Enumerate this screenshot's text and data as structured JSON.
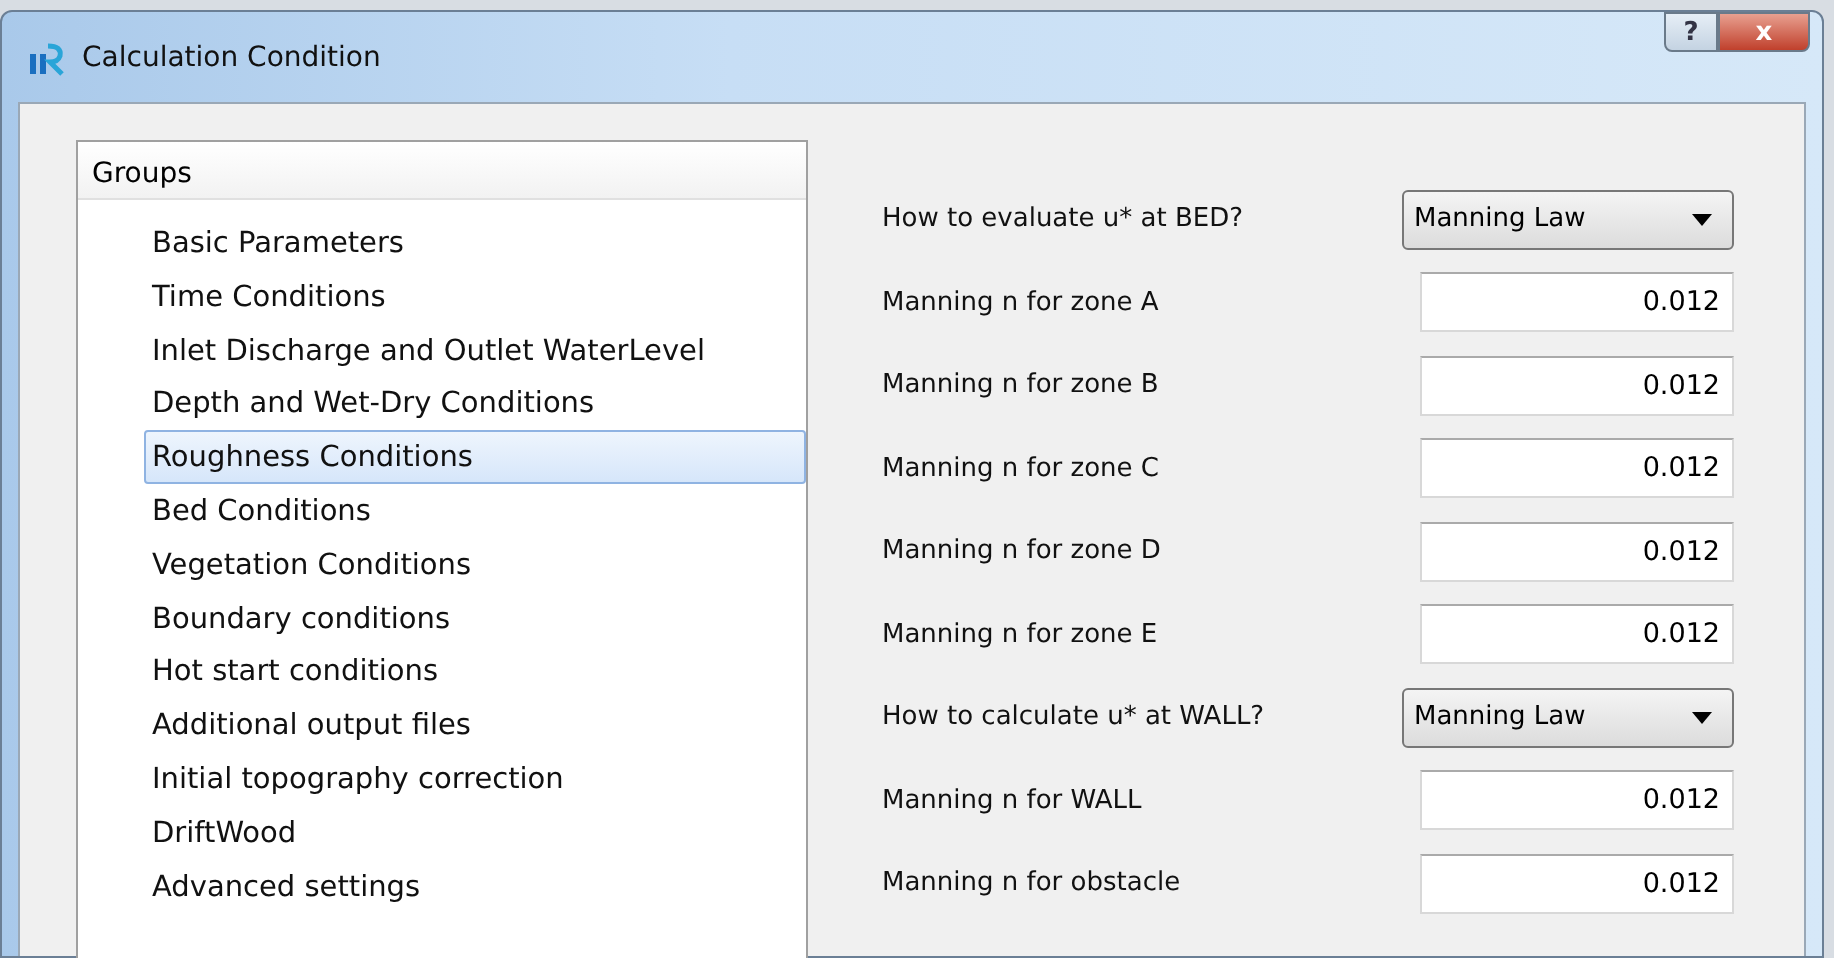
{
  "window": {
    "title": "Calculation Condition",
    "help_button": "?",
    "close_button": "x"
  },
  "groups": {
    "header": "Groups",
    "items": [
      {
        "label": "Basic Parameters",
        "selected": false
      },
      {
        "label": "Time Conditions",
        "selected": false
      },
      {
        "label": "Inlet Discharge and Outlet WaterLevel",
        "selected": false
      },
      {
        "label": "Depth and Wet-Dry Conditions",
        "selected": false
      },
      {
        "label": "Roughness Conditions",
        "selected": true
      },
      {
        "label": "Bed Conditions",
        "selected": false
      },
      {
        "label": "Vegetation Conditions",
        "selected": false
      },
      {
        "label": "Boundary conditions",
        "selected": false
      },
      {
        "label": "Hot start conditions",
        "selected": false
      },
      {
        "label": "Additional output files",
        "selected": false
      },
      {
        "label": "Initial topography correction",
        "selected": false
      },
      {
        "label": "DriftWood",
        "selected": false
      },
      {
        "label": "Advanced settings",
        "selected": false
      }
    ]
  },
  "fields": [
    {
      "kind": "combo",
      "label": "How to evaluate u* at BED?",
      "value": "Manning Law"
    },
    {
      "kind": "number",
      "label": "Manning n for zone A",
      "value": "0.012"
    },
    {
      "kind": "number",
      "label": "Manning n for zone B",
      "value": "0.012"
    },
    {
      "kind": "number",
      "label": "Manning n for zone C",
      "value": "0.012"
    },
    {
      "kind": "number",
      "label": "Manning n for zone D",
      "value": "0.012"
    },
    {
      "kind": "number",
      "label": "Manning n for zone E",
      "value": "0.012"
    },
    {
      "kind": "combo",
      "label": "How to calculate u* at WALL?",
      "value": "Manning Law"
    },
    {
      "kind": "number",
      "label": "Manning n for WALL",
      "value": "0.012"
    },
    {
      "kind": "number",
      "label": "Manning n for obstacle",
      "value": "0.012"
    }
  ]
}
